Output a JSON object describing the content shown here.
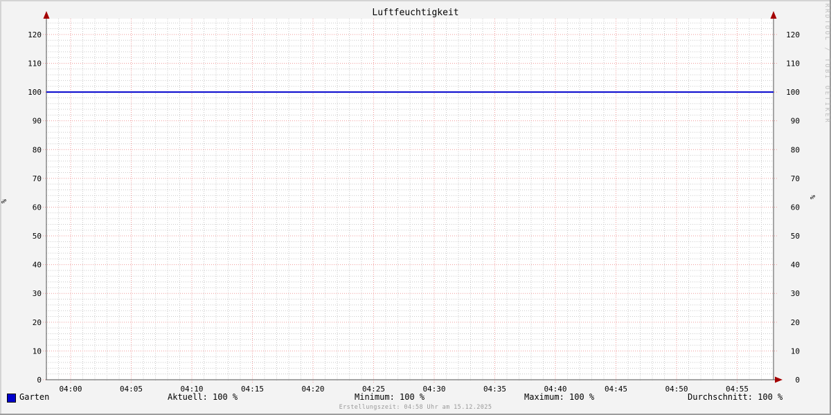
{
  "title": "Luftfeuchtigkeit",
  "vertical_label": "%",
  "watermark": "RRDTOOL / TOBI OETIKER",
  "footer": "Erstellungszeit: 04:58 Uhr am 15.12.2025",
  "legend": {
    "series": "Garten",
    "series_color": "#0000cc",
    "aktuell": "Aktuell: 100 %",
    "minimum": "Minimum: 100 %",
    "maximum": "Maximum: 100 %",
    "durchschnitt": "Durchschnitt: 100 %"
  },
  "colors": {
    "background": "#f3f3f3",
    "canvas": "#ffffff",
    "major_grid": "#f09a9a",
    "minor_grid": "#c8c8c8",
    "axis": "#525252",
    "arrow": "#a40000",
    "series": "#0000cc",
    "text": "#000000"
  },
  "chart_data": {
    "type": "line",
    "title": "Luftfeuchtigkeit",
    "ylabel": "%",
    "ylim": [
      0,
      125.5
    ],
    "y_major_ticks": [
      0,
      10,
      20,
      30,
      40,
      50,
      60,
      70,
      80,
      90,
      100,
      110,
      120
    ],
    "y_minor_step": 2,
    "x_tick_labels": [
      "04:00",
      "04:05",
      "04:10",
      "04:15",
      "04:20",
      "04:25",
      "04:30",
      "04:35",
      "04:40",
      "04:45",
      "04:50",
      "04:55"
    ],
    "x_total_minutes": 60,
    "x_first_tick_minute": 2,
    "x_tick_step_minutes": 5,
    "x_minor_step_minutes": 1,
    "grid": true,
    "legend_position": "bottom",
    "series": [
      {
        "name": "Garten",
        "color": "#0000cc",
        "constant_value": 100
      }
    ],
    "stats": {
      "aktuell": "100 %",
      "minimum": "100 %",
      "maximum": "100 %",
      "durchschnitt": "100 %"
    }
  }
}
